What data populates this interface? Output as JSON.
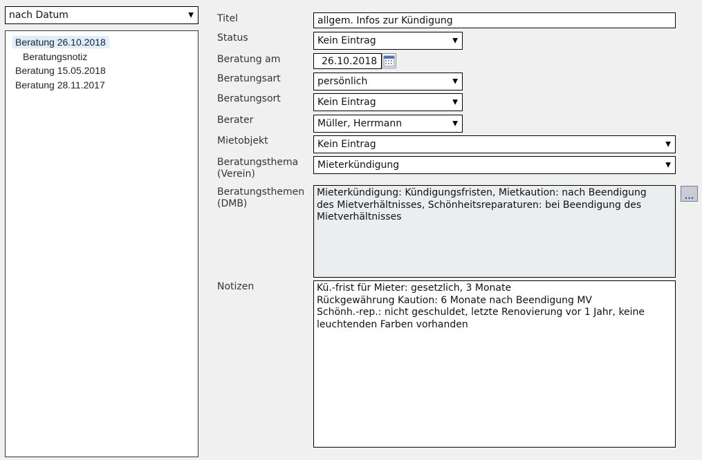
{
  "sort_select": {
    "value": "nach Datum"
  },
  "tree": {
    "items": [
      {
        "label": "Beratung 26.10.2018"
      },
      {
        "label": "Beratungsnotiz"
      },
      {
        "label": "Beratung 15.05.2018"
      },
      {
        "label": "Beratung 28.11.2017"
      }
    ]
  },
  "form": {
    "titel": {
      "label": "Titel",
      "value": "allgem. Infos zur Kündigung"
    },
    "status": {
      "label": "Status",
      "value": "Kein Eintrag"
    },
    "beratung_am": {
      "label": "Beratung am",
      "value": "26.10.2018"
    },
    "beratungsart": {
      "label": "Beratungsart",
      "value": "persönlich"
    },
    "beratungsort": {
      "label": "Beratungsort",
      "value": "Kein Eintrag"
    },
    "berater": {
      "label": "Berater",
      "value": "Müller, Herrmann"
    },
    "mietobjekt": {
      "label": "Mietobjekt",
      "value": "Kein Eintrag"
    },
    "thema_verein": {
      "label_line1": "Beratungsthema",
      "label_line2": "(Verein)",
      "value": "Mieterkündigung"
    },
    "themen_dmb": {
      "label_line1": "Beratungsthemen",
      "label_line2": "(DMB)",
      "lines": [
        "Mieterkündigung: Kündigungsfristen, Mietkaution: nach Beendigung",
        "des Mietverhältnisses, Schönheitsreparaturen: bei Beendigung des",
        "Mietverhältnisses"
      ],
      "picker_label": "..."
    },
    "notizen": {
      "label": "Notizen",
      "lines": [
        "Kü.-frist für Mieter: gesetzlich, 3 Monate",
        "Rückgewährung Kaution: 6 Monate nach Beendigung MV",
        "Schönh.-rep.: nicht geschuldet, letzte Renovierung vor 1 Jahr, keine",
        "leuchtenden Farben vorhanden"
      ]
    }
  },
  "icons": {
    "dropdown": "▼",
    "calendar": "calendar-icon"
  }
}
